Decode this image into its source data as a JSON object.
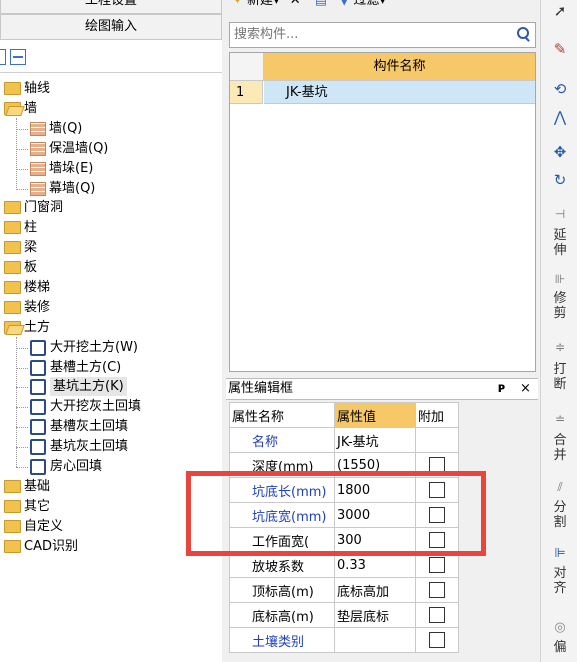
{
  "left": {
    "header1": "工程设置",
    "header2": "绘图输入",
    "tree": [
      {
        "label": "轴线",
        "kind": "folder",
        "level": 0
      },
      {
        "label": "墙",
        "kind": "folder-open",
        "level": 0
      },
      {
        "label": "墙(Q)",
        "kind": "wall",
        "level": 1
      },
      {
        "label": "保温墙(Q)",
        "kind": "wall",
        "level": 1
      },
      {
        "label": "墙垛(E)",
        "kind": "wall",
        "level": 1
      },
      {
        "label": "幕墙(Q)",
        "kind": "wall",
        "level": 1
      },
      {
        "label": "门窗洞",
        "kind": "folder",
        "level": 0
      },
      {
        "label": "柱",
        "kind": "folder",
        "level": 0
      },
      {
        "label": "梁",
        "kind": "folder",
        "level": 0
      },
      {
        "label": "板",
        "kind": "folder",
        "level": 0
      },
      {
        "label": "楼梯",
        "kind": "folder",
        "level": 0
      },
      {
        "label": "装修",
        "kind": "folder",
        "level": 0
      },
      {
        "label": "土方",
        "kind": "folder-open",
        "level": 0
      },
      {
        "label": "大开挖土方(W)",
        "kind": "pit",
        "level": 1
      },
      {
        "label": "基槽土方(C)",
        "kind": "pit",
        "level": 1
      },
      {
        "label": "基坑土方(K)",
        "kind": "pit",
        "level": 1,
        "selected": true
      },
      {
        "label": "大开挖灰土回填",
        "kind": "pit",
        "level": 1
      },
      {
        "label": "基槽灰土回填",
        "kind": "pit",
        "level": 1
      },
      {
        "label": "基坑灰土回填",
        "kind": "pit",
        "level": 1
      },
      {
        "label": "房心回填",
        "kind": "pit",
        "level": 1
      },
      {
        "label": "基础",
        "kind": "folder",
        "level": 0
      },
      {
        "label": "其它",
        "kind": "folder",
        "level": 0
      },
      {
        "label": "自定义",
        "kind": "folder",
        "level": 0
      },
      {
        "label": "CAD识别",
        "kind": "folder",
        "level": 0
      }
    ]
  },
  "toolbar": {
    "new": "新建",
    "filter": "过滤"
  },
  "search": {
    "placeholder": "搜索构件..."
  },
  "grid": {
    "col_header": "构件名称",
    "rows": [
      {
        "num": "1",
        "name": "JK-基坑"
      }
    ]
  },
  "props": {
    "title": "属性编辑框",
    "pin": "ᴘ",
    "close": "×",
    "headers": {
      "name": "属性名称",
      "value": "属性值",
      "extra": "附加"
    },
    "rows": [
      {
        "name": "名称",
        "value": "JK-基坑",
        "blue": true,
        "checkbox": false
      },
      {
        "name": "深度(mm)",
        "value": "(1550)",
        "blue": false,
        "checkbox": true
      },
      {
        "name": "坑底长(mm)",
        "value": "1800",
        "blue": true,
        "checkbox": true
      },
      {
        "name": "坑底宽(mm)",
        "value": "3000",
        "blue": true,
        "checkbox": true
      },
      {
        "name": "工作面宽(",
        "value": "300",
        "blue": false,
        "checkbox": true
      },
      {
        "name": "放坡系数",
        "value": "0.33",
        "blue": false,
        "checkbox": true
      },
      {
        "name": "顶标高(m)",
        "value": "底标高加",
        "blue": false,
        "checkbox": true
      },
      {
        "name": "底标高(m)",
        "value": "垫层底标",
        "blue": false,
        "checkbox": true
      },
      {
        "name": "土壤类别",
        "value": "",
        "blue": true,
        "checkbox": true
      }
    ]
  },
  "tools": {
    "extend": "延伸",
    "trim": "修剪",
    "break": "打断",
    "merge": "合并",
    "split": "分割",
    "align": "对齐",
    "offset": "偏"
  },
  "colors": {
    "accent": "#f7c868",
    "selected_row": "#cfe6f7",
    "highlight": "#e8453c"
  }
}
